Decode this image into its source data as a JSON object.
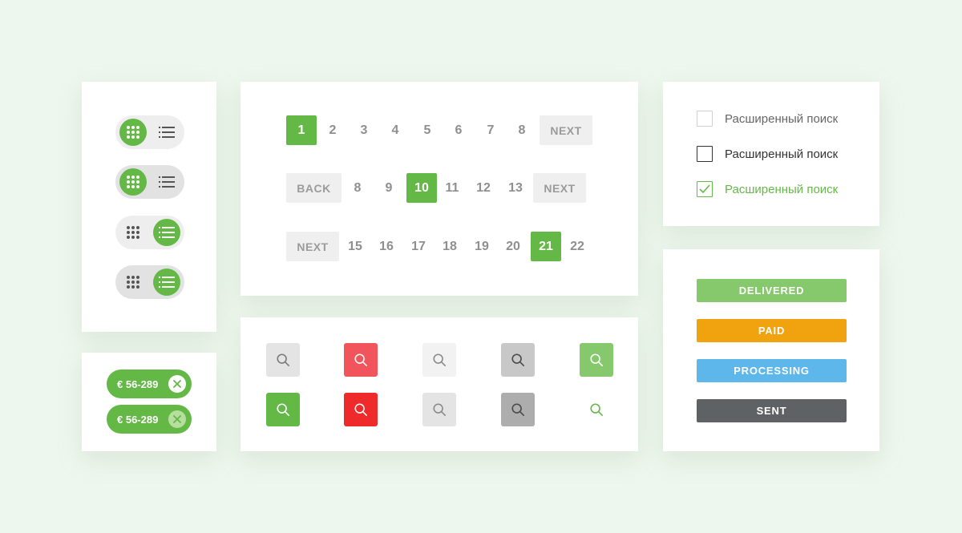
{
  "toggles": {
    "items": [
      {
        "active": "grid",
        "bg": "light"
      },
      {
        "active": "grid",
        "bg": "dark"
      },
      {
        "active": "list",
        "bg": "light"
      },
      {
        "active": "list",
        "bg": "dark"
      }
    ],
    "icons": {
      "grid": "grid-icon",
      "list": "list-icon"
    }
  },
  "chips": [
    {
      "label": "€ 56-289",
      "close_icon": "close-icon",
      "style": "light"
    },
    {
      "label": "€ 56-289",
      "close_icon": "close-icon",
      "style": "pale"
    }
  ],
  "pagination": {
    "rows": [
      [
        {
          "label": "1",
          "type": "num",
          "active": true
        },
        {
          "label": "2",
          "type": "num"
        },
        {
          "label": "3",
          "type": "num"
        },
        {
          "label": "4",
          "type": "num"
        },
        {
          "label": "5",
          "type": "num"
        },
        {
          "label": "6",
          "type": "num"
        },
        {
          "label": "7",
          "type": "num"
        },
        {
          "label": "8",
          "type": "num"
        },
        {
          "label": "NEXT",
          "type": "btn"
        }
      ],
      [
        {
          "label": "BACK",
          "type": "btn"
        },
        {
          "label": "8",
          "type": "num"
        },
        {
          "label": "9",
          "type": "num"
        },
        {
          "label": "10",
          "type": "num",
          "active": true
        },
        {
          "label": "11",
          "type": "num"
        },
        {
          "label": "12",
          "type": "num"
        },
        {
          "label": "13",
          "type": "num"
        },
        {
          "label": "NEXT",
          "type": "btn"
        }
      ],
      [
        {
          "label": "NEXT",
          "type": "btn"
        },
        {
          "label": "15",
          "type": "num"
        },
        {
          "label": "16",
          "type": "num"
        },
        {
          "label": "17",
          "type": "num"
        },
        {
          "label": "18",
          "type": "num"
        },
        {
          "label": "19",
          "type": "num"
        },
        {
          "label": "20",
          "type": "num"
        },
        {
          "label": "21",
          "type": "num",
          "active": true
        },
        {
          "label": "22",
          "type": "num"
        }
      ]
    ],
    "colors": {
      "active": "#64b846",
      "text": "#8f8f8f",
      "button_bg": "#efefef"
    }
  },
  "search_buttons": {
    "icon": "search-icon",
    "rows": [
      [
        {
          "bg": "#e4e4e4",
          "fg": "#7a7a7a"
        },
        {
          "bg": "#f2545b",
          "fg": "#ffffff"
        },
        {
          "bg": "#f2f2f2",
          "fg": "#8a8a8a"
        },
        {
          "bg": "#c8c8c8",
          "fg": "#4a4a4a"
        },
        {
          "bg": "#86c96d",
          "fg": "#ffffff"
        }
      ],
      [
        {
          "bg": "#64b846",
          "fg": "#ffffff"
        },
        {
          "bg": "#ee2a2a",
          "fg": "#ffffff"
        },
        {
          "bg": "#e4e4e4",
          "fg": "#8a8a8a"
        },
        {
          "bg": "#adadad",
          "fg": "#4a4a4a"
        },
        {
          "bg": "transparent",
          "fg": "#64b846"
        }
      ]
    ]
  },
  "checkboxes": [
    {
      "label": "Расширенный поиск",
      "state": "unchecked-light",
      "color": "#666666"
    },
    {
      "label": "Расширенный поиск",
      "state": "unchecked-dark",
      "color": "#333333"
    },
    {
      "label": "Расширенный поиск",
      "state": "checked",
      "color": "#64b846",
      "icon": "check-icon"
    }
  ],
  "statuses": [
    {
      "label": "DELIVERED",
      "color": "#86c96d"
    },
    {
      "label": "PAID",
      "color": "#f0a20f"
    },
    {
      "label": "PROCESSING",
      "color": "#5db7ea"
    },
    {
      "label": "SENT",
      "color": "#5f6264"
    }
  ]
}
